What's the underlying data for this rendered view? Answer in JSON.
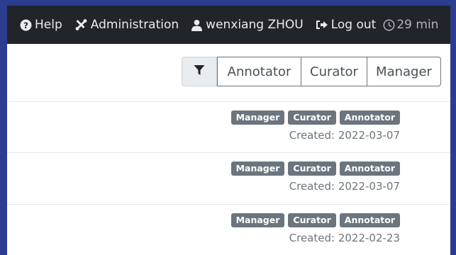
{
  "navbar": {
    "help_label": "Help",
    "admin_label": "Administration",
    "user_label": "wenxiang ZHOU",
    "logout_label": "Log out",
    "timer_label": "29 min",
    "icons": {
      "help": "question-circle-icon",
      "admin": "tools-icon",
      "user": "user-icon",
      "logout": "sign-out-icon",
      "timer": "clock-icon"
    }
  },
  "filter": {
    "icon": "funnel-icon",
    "annotator_label": "Annotator",
    "curator_label": "Curator",
    "manager_label": "Manager"
  },
  "rows": [
    {
      "badges": [
        "Manager",
        "Curator",
        "Annotator"
      ],
      "created": "Created: 2022-03-07"
    },
    {
      "badges": [
        "Manager",
        "Curator",
        "Annotator"
      ],
      "created": "Created: 2022-03-07"
    },
    {
      "badges": [
        "Manager",
        "Curator",
        "Annotator"
      ],
      "created": "Created: 2022-02-23"
    }
  ],
  "colors": {
    "navbar_bg": "#212529",
    "badge_bg": "#6c757d",
    "frame_border": "#2c3d8f"
  }
}
